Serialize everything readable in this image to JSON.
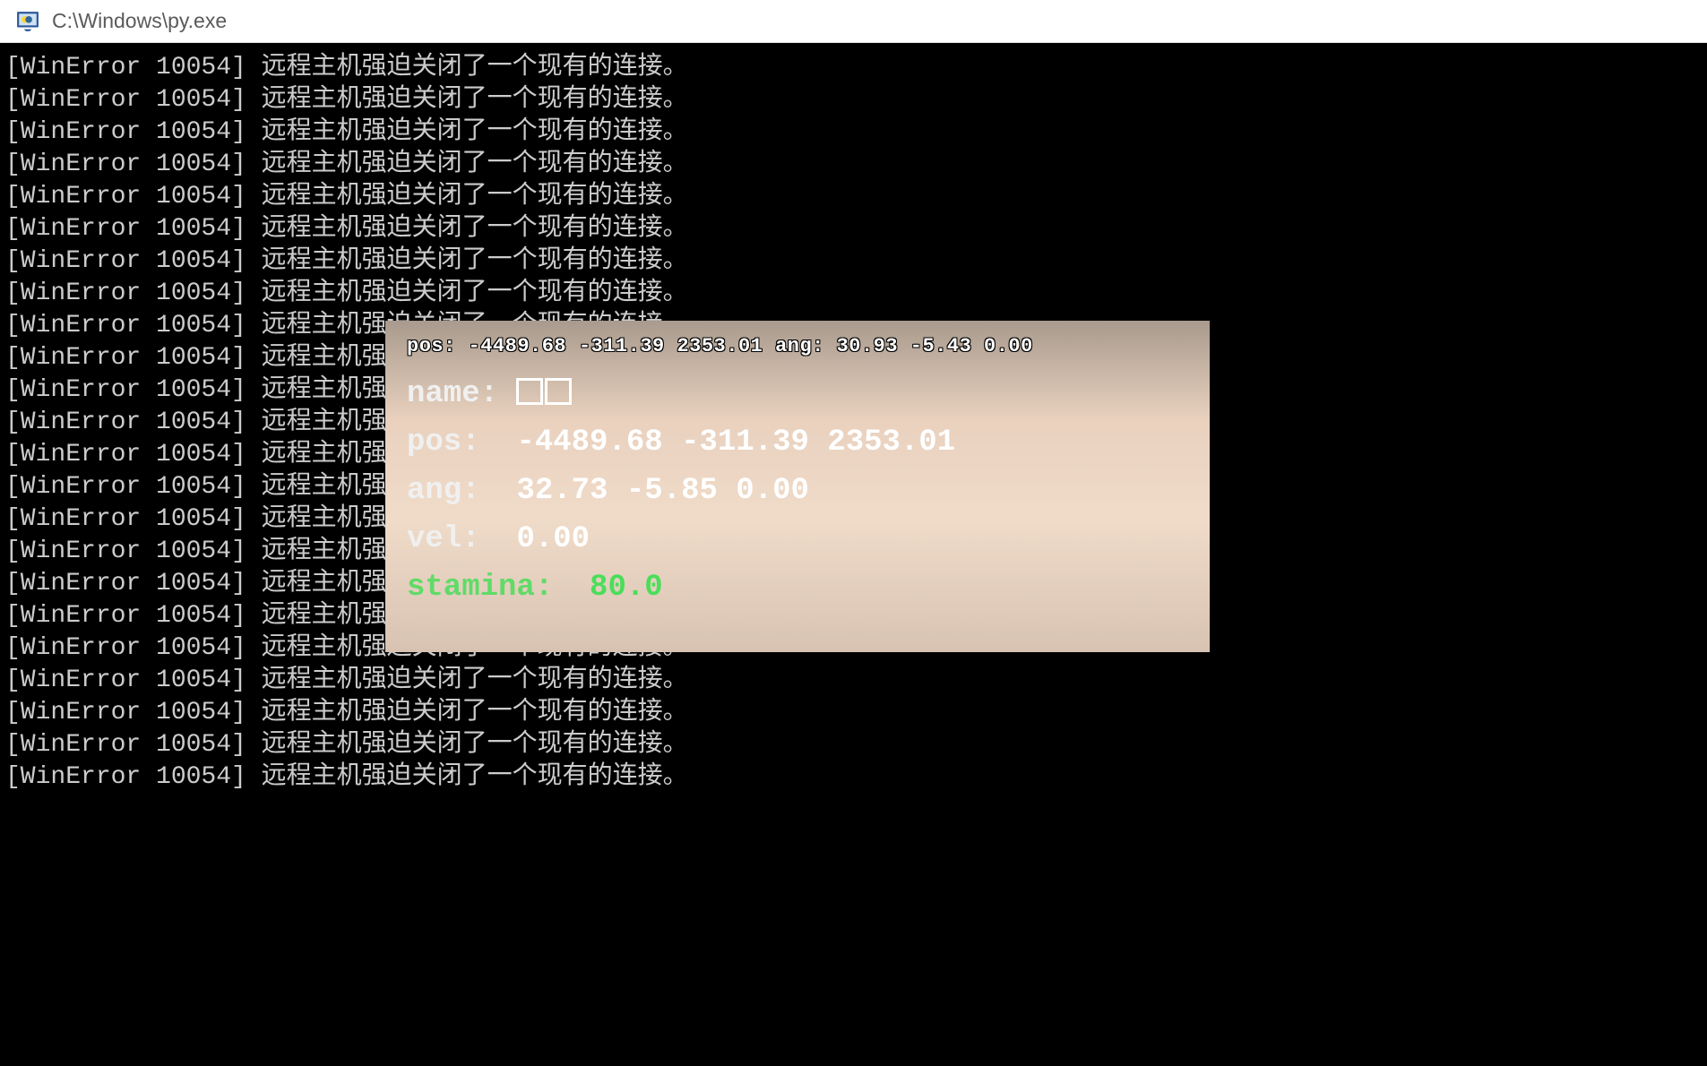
{
  "window": {
    "title": "C:\\Windows\\py.exe"
  },
  "console": {
    "error_prefix": "[WinError 10054]",
    "error_message": "远程主机强迫关闭了一个现有的连接。",
    "line_count": 23,
    "truncated_message": "远程主机强",
    "truncated_message_2": "远程主机强迫关闭了一个现有的连接。"
  },
  "overlay": {
    "topline": "pos: -4489.68 -311.39 2353.01 ang: 30.93 -5.43 0.00",
    "name_label": "name:",
    "name_value": "□□",
    "pos_label": "pos:",
    "pos_value": "-4489.68 -311.39 2353.01",
    "ang_label": "ang:",
    "ang_value": "32.73 -5.85 0.00",
    "vel_label": "vel:",
    "vel_value": "0.00",
    "stamina_label": "stamina:",
    "stamina_value": "80.0"
  }
}
